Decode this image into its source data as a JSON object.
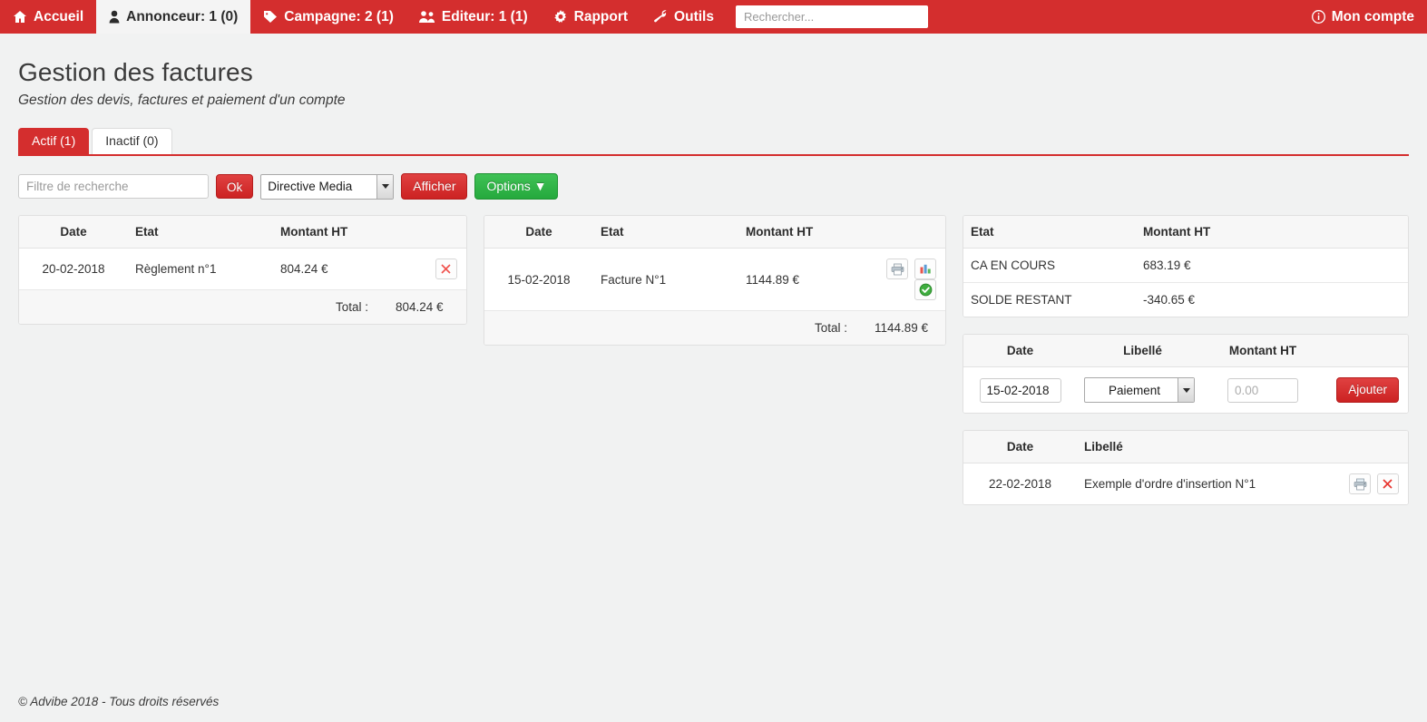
{
  "nav": {
    "items": [
      {
        "label": "Accueil",
        "icon": "home-icon",
        "active": false
      },
      {
        "label": "Annonceur: 1 (0)",
        "icon": "user-icon",
        "active": true
      },
      {
        "label": "Campagne: 2 (1)",
        "icon": "tag-icon",
        "active": false
      },
      {
        "label": "Editeur: 1 (1)",
        "icon": "users-icon",
        "active": false
      },
      {
        "label": "Rapport",
        "icon": "gear-icon",
        "active": false
      },
      {
        "label": "Outils",
        "icon": "wrench-icon",
        "active": false
      }
    ],
    "search_placeholder": "Rechercher...",
    "account_label": "Mon compte",
    "account_icon": "info-circle-icon"
  },
  "header": {
    "title": "Gestion des factures",
    "subtitle": "Gestion des devis, factures et paiement d'un compte"
  },
  "tabs": [
    {
      "label": "Actif (1)",
      "active": true
    },
    {
      "label": "Inactif (0)",
      "active": false
    }
  ],
  "filterbar": {
    "search_placeholder": "Filtre de recherche",
    "search_value": "",
    "ok_label": "Ok",
    "select_value": "Directive Media",
    "afficher_label": "Afficher",
    "options_label": "Options ▼"
  },
  "payments_table": {
    "headers": {
      "date": "Date",
      "etat": "Etat",
      "amount": "Montant HT"
    },
    "rows": [
      {
        "date": "20-02-2018",
        "etat": "Règlement n°1",
        "amount": "804.24 €",
        "actions": [
          "delete-icon"
        ]
      }
    ],
    "total_label": "Total :",
    "total_value": "804.24 €"
  },
  "invoices_table": {
    "headers": {
      "date": "Date",
      "etat": "Etat",
      "amount": "Montant HT"
    },
    "rows": [
      {
        "date": "15-02-2018",
        "etat": "Facture N°1",
        "amount": "1144.89 €",
        "actions": [
          "print-icon",
          "chart-icon",
          "validate-icon"
        ]
      }
    ],
    "total_label": "Total :",
    "total_value": "1144.89 €"
  },
  "summary_table": {
    "headers": {
      "etat": "Etat",
      "amount": "Montant HT"
    },
    "rows": [
      {
        "label": "CA EN COURS",
        "amount": "683.19 €"
      },
      {
        "label": "SOLDE RESTANT",
        "amount": "-340.65 €"
      }
    ]
  },
  "add_payment_form": {
    "headers": {
      "date": "Date",
      "libelle": "Libellé",
      "amount": "Montant HT"
    },
    "date_value": "15-02-2018",
    "libelle_value": "Paiement",
    "amount_placeholder": "0.00",
    "amount_value": "",
    "add_label": "Ajouter"
  },
  "orders_table": {
    "headers": {
      "date": "Date",
      "libelle": "Libellé"
    },
    "rows": [
      {
        "date": "22-02-2018",
        "libelle": "Exemple d'ordre d'insertion N°1",
        "actions": [
          "print-icon",
          "delete-icon"
        ]
      }
    ]
  },
  "footer": {
    "text": "© Advibe 2018 - Tous droits réservés"
  },
  "colors": {
    "brand_red": "#d42e2e",
    "accent_green": "#2ca83d",
    "amount_red": "#d4332e",
    "page_bg": "#f1f2f2"
  }
}
